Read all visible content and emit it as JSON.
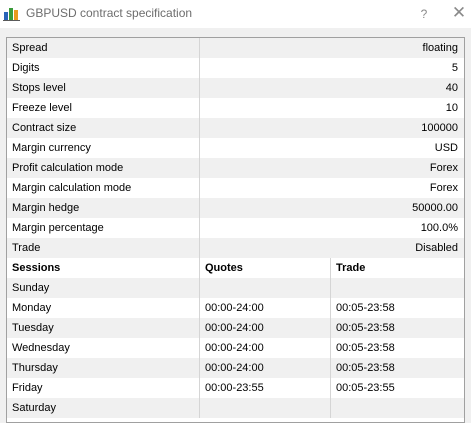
{
  "window": {
    "title": "GBPUSD contract specification",
    "help_label": "?",
    "close_label": "✕"
  },
  "specs": [
    {
      "key": "Spread",
      "value": "floating"
    },
    {
      "key": "Digits",
      "value": "5"
    },
    {
      "key": "Stops level",
      "value": "40"
    },
    {
      "key": "Freeze level",
      "value": "10"
    },
    {
      "key": "Contract size",
      "value": "100000"
    },
    {
      "key": "Margin currency",
      "value": "USD"
    },
    {
      "key": "Profit calculation mode",
      "value": "Forex"
    },
    {
      "key": "Margin calculation mode",
      "value": "Forex"
    },
    {
      "key": "Margin hedge",
      "value": "50000.00"
    },
    {
      "key": "Margin percentage",
      "value": "100.0%"
    },
    {
      "key": "Trade",
      "value": "Disabled"
    }
  ],
  "sessions": {
    "headers": [
      "Sessions",
      "Quotes",
      "Trade"
    ],
    "rows": [
      {
        "day": "Sunday",
        "quotes": "",
        "trade": ""
      },
      {
        "day": "Monday",
        "quotes": "00:00-24:00",
        "trade": "00:05-23:58"
      },
      {
        "day": "Tuesday",
        "quotes": "00:00-24:00",
        "trade": "00:05-23:58"
      },
      {
        "day": "Wednesday",
        "quotes": "00:00-24:00",
        "trade": "00:05-23:58"
      },
      {
        "day": "Thursday",
        "quotes": "00:00-24:00",
        "trade": "00:05-23:58"
      },
      {
        "day": "Friday",
        "quotes": "00:00-23:55",
        "trade": "00:05-23:55"
      },
      {
        "day": "Saturday",
        "quotes": "",
        "trade": ""
      }
    ]
  },
  "colors": {
    "row_alt": "#f0f0f0",
    "row_base": "#ffffff",
    "grid": "#d5d5d5",
    "icon_green": "#3a9b3a",
    "icon_blue": "#2a64b8",
    "icon_orange": "#e89a1e"
  }
}
